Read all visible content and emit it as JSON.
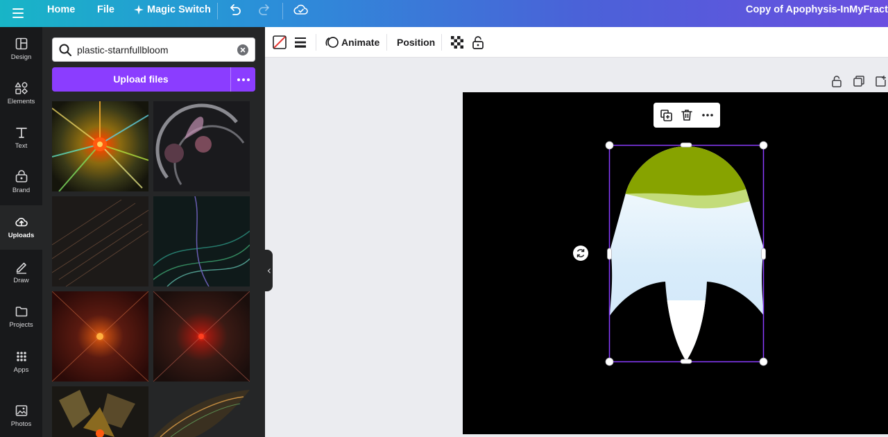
{
  "topbar": {
    "home": "Home",
    "file": "File",
    "magic_switch": "Magic Switch",
    "title": "Copy of Apophysis-InMyFractal"
  },
  "rail": {
    "items": [
      {
        "label": "Design",
        "icon": "layout-icon"
      },
      {
        "label": "Elements",
        "icon": "shapes-icon"
      },
      {
        "label": "Text",
        "icon": "text-icon"
      },
      {
        "label": "Brand",
        "icon": "brand-icon"
      },
      {
        "label": "Uploads",
        "icon": "cloud-upload-icon",
        "active": true
      },
      {
        "label": "Draw",
        "icon": "pen-icon"
      },
      {
        "label": "Projects",
        "icon": "folder-icon"
      },
      {
        "label": "Apps",
        "icon": "grid-icon"
      },
      {
        "label": "Photos",
        "icon": "image-icon"
      }
    ]
  },
  "panel": {
    "search_value": "plastic-starnfullbloom",
    "upload_label": "Upload files"
  },
  "editor_toolbar": {
    "animate": "Animate",
    "position": "Position"
  },
  "colors": {
    "accent": "#8b3dff",
    "selection": "#8b3dff",
    "flower_top": "#87a300",
    "flower_light": "#c3dc7a",
    "flower_body": "#dcedfa"
  }
}
